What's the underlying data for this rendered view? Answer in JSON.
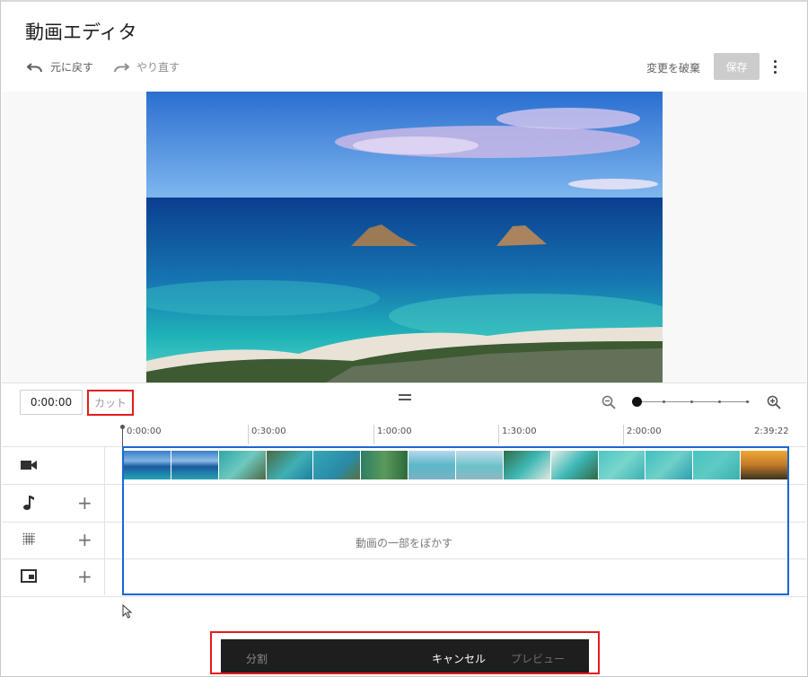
{
  "header": {
    "title": "動画エディタ",
    "undo_label": "元に戻す",
    "redo_label": "やり直す",
    "discard_label": "変更を破棄",
    "save_label": "保存"
  },
  "controls": {
    "current_time": "0:00:00",
    "cut_label": "カット",
    "zoom_level": 0
  },
  "timeline": {
    "ruler": [
      "0:00:00",
      "0:30:00",
      "1:00:00",
      "1:30:00",
      "2:00:00",
      "2:39:22"
    ],
    "blur_track_label": "動画の一部をぼかす"
  },
  "bottom_bar": {
    "split_label": "分割",
    "cancel_label": "キャンセル",
    "preview_label": "プレビュー"
  },
  "icons": {
    "undo": "undo-icon",
    "redo": "redo-icon",
    "more": "more-vert-icon",
    "zoom_out": "zoom-out-icon",
    "zoom_in": "zoom-in-icon",
    "video_track": "video-camera-icon",
    "audio_track": "music-note-icon",
    "blur_track": "blur-icon",
    "endscreen_track": "endscreen-icon"
  },
  "colors": {
    "selection": "#1a66d6",
    "highlight": "#e41b1b",
    "save_disabled": "#cccccc",
    "bottom_bar": "#1e1e1e"
  }
}
